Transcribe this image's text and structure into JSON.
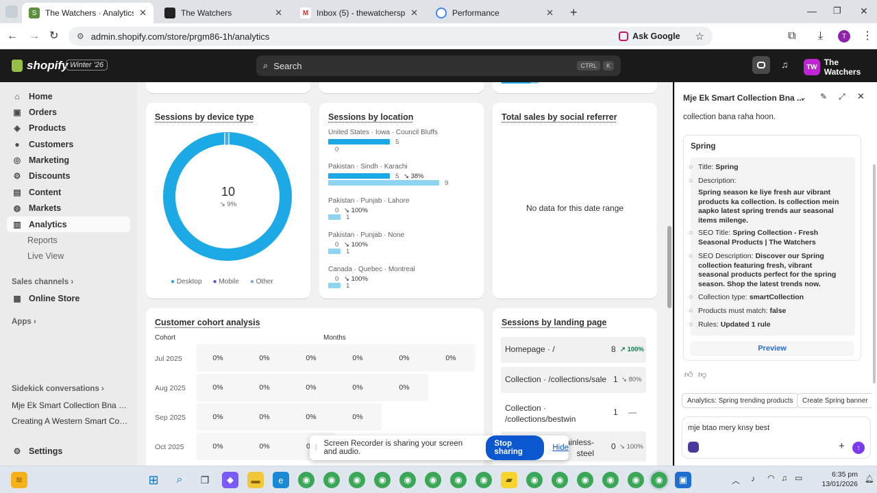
{
  "browser": {
    "tabs": [
      {
        "title": "The Watchers · Analytics · Shopi",
        "active": true
      },
      {
        "title": "The Watchers"
      },
      {
        "title": "Inbox (5) - thewatcherspk@gm"
      },
      {
        "title": "Performance"
      }
    ],
    "url": "admin.shopify.com/store/prgm86-1h/analytics",
    "ask_google": "Ask Google",
    "profile_initial": "T"
  },
  "shopify": {
    "logo_text": "shopify",
    "edition_badge": "Winter '26",
    "search_placeholder": "Search",
    "shortcut_ctrl": "CTRL",
    "shortcut_k": "K",
    "store_initials": "TW",
    "store_name": "The Watchers"
  },
  "sidebar": {
    "items": [
      {
        "label": "Home"
      },
      {
        "label": "Orders"
      },
      {
        "label": "Products"
      },
      {
        "label": "Customers"
      },
      {
        "label": "Marketing"
      },
      {
        "label": "Discounts"
      },
      {
        "label": "Content"
      },
      {
        "label": "Markets"
      },
      {
        "label": "Analytics"
      },
      {
        "label": "Reports"
      },
      {
        "label": "Live View"
      }
    ],
    "sales_channels": "Sales channels",
    "online_store": "Online Store",
    "apps": "Apps",
    "sidekick_conversations": "Sidekick conversations",
    "conversations": [
      "Mje Ek Smart Collection Bna K...",
      "Creating A Western Smart Coll..."
    ],
    "settings": "Settings"
  },
  "device_card": {
    "title": "Sessions by device type",
    "total": "10",
    "change": "↘ 9%",
    "legend": [
      "Desktop",
      "Mobile",
      "Other"
    ],
    "colors": {
      "desktop": "#1ca9e6",
      "mobile": "#5a4fcf",
      "other": "#7b9df0"
    }
  },
  "location_card": {
    "title": "Sessions by location",
    "rows": [
      {
        "label": "United States · Iowa · Council Bluffs",
        "current": "5",
        "previous": "0",
        "change": ""
      },
      {
        "label": "Pakistan · Sindh · Karachi",
        "current": "5",
        "previous": "9",
        "change": "↘ 38%"
      },
      {
        "label": "Pakistan · Punjab · Lahore",
        "current": "0",
        "previous": "1",
        "change": "↘ 100%"
      },
      {
        "label": "Pakistan · Punjab · None",
        "current": "0",
        "previous": "1",
        "change": "↘ 100%"
      },
      {
        "label": "Canada · Quebec · Montreal",
        "current": "0",
        "previous": "1",
        "change": "↘ 100%"
      }
    ]
  },
  "social_card": {
    "title": "Total sales by social referrer",
    "empty": "No data for this date range"
  },
  "cohort_card": {
    "title": "Customer cohort analysis",
    "col_cohort": "Cohort",
    "col_months": "Months",
    "rows": [
      {
        "label": "Jul 2025",
        "cells": [
          "0%",
          "0%",
          "0%",
          "0%",
          "0%",
          "0%"
        ]
      },
      {
        "label": "Aug 2025",
        "cells": [
          "0%",
          "0%",
          "0%",
          "0%",
          "0%"
        ]
      },
      {
        "label": "Sep 2025",
        "cells": [
          "0%",
          "0%",
          "0%",
          "0%"
        ]
      },
      {
        "label": "Oct 2025",
        "cells": [
          "0%",
          "0%",
          "0"
        ]
      }
    ]
  },
  "landing_card": {
    "title": "Sessions by landing page",
    "rows": [
      {
        "page": "Homepage · /",
        "value": "8",
        "change": "↗ 100%"
      },
      {
        "page": "Collection · /collections/sale",
        "value": "1",
        "change": "↘ 80%"
      },
      {
        "page": "Collection · /collections/bestwin",
        "value": "1",
        "change": "—"
      },
      {
        "page": "s/rolex-datejust-stainless-steel",
        "value": "0",
        "change": "↘ 100%"
      }
    ]
  },
  "sidekick": {
    "title": "Mje Ek Smart Collection Bna ...",
    "intro_tail": "collection bana raha hoon.",
    "card_title": "Spring",
    "fields": {
      "title_label": "Title:",
      "title_value": "Spring",
      "desc_label": "Description:",
      "desc_value": "Spring season ke liye fresh aur vibrant products ka collection. Is collection mein aapko latest spring trends aur seasonal items milenge.",
      "seo_title_label": "SEO Title:",
      "seo_title_value": "Spring Collection - Fresh Seasonal Products | The Watchers",
      "seo_desc_label": "SEO Description:",
      "seo_desc_value": "Discover our Spring collection featuring fresh, vibrant seasonal products perfect for the spring season. Shop the latest trends now.",
      "type_label": "Collection type:",
      "type_value": "smartCollection",
      "match_label": "Products must match:",
      "match_value": "false",
      "rules_label": "Rules:",
      "rules_value": "Updated 1 rule"
    },
    "preview_button": "Preview",
    "chips": [
      "Analytics: Spring trending products",
      "Create Spring banner"
    ],
    "input_value": "mje btao mery knsy best"
  },
  "share_banner": {
    "text": "Screen Recorder is sharing your screen and audio.",
    "stop": "Stop sharing",
    "hide": "Hide"
  },
  "taskbar": {
    "time": "6:35 pm",
    "date": "13/01/2026"
  }
}
